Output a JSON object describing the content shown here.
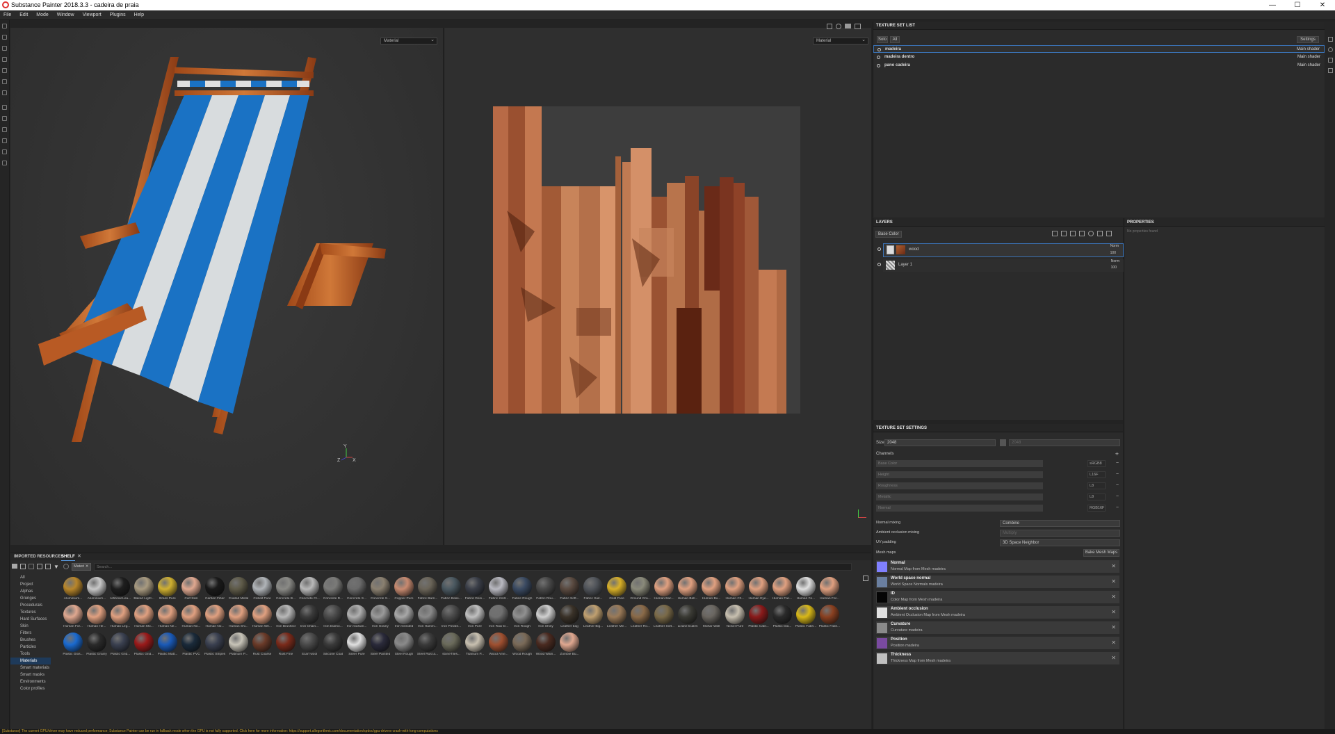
{
  "window": {
    "title": "Substance Painter 2018.3.3 - cadeira de praia"
  },
  "menu": [
    "File",
    "Edit",
    "Mode",
    "Window",
    "Viewport",
    "Plugins",
    "Help"
  ],
  "viewport3d": {
    "mode": "Material"
  },
  "viewport2d": {
    "mode": "Material"
  },
  "texture_set_list": {
    "title": "TEXTURE SET LIST",
    "solo": "Solo",
    "all": "All",
    "settings": "Settings",
    "items": [
      {
        "name": "madeira",
        "shader": "Main shader"
      },
      {
        "name": "madeira dentro",
        "shader": "Main shader"
      },
      {
        "name": "pano cadeira",
        "shader": "Main shader"
      }
    ]
  },
  "layers": {
    "title": "LAYERS",
    "channel": "Base Color",
    "items": [
      {
        "name": "wood",
        "blend": "Norm",
        "opacity": "100"
      },
      {
        "name": "Layer 1",
        "blend": "Norm",
        "opacity": "100"
      }
    ]
  },
  "properties": {
    "title": "PROPERTIES",
    "empty": "No properties found"
  },
  "texture_set_settings": {
    "title": "TEXTURE SET SETTINGS",
    "size_label": "Size",
    "size_value": "2048",
    "size_value2": "2048",
    "channels_label": "Channels",
    "channels": [
      {
        "name": "Base Color",
        "format": "sRGB8"
      },
      {
        "name": "Height",
        "format": "L16F"
      },
      {
        "name": "Roughness",
        "format": "L8"
      },
      {
        "name": "Metallic",
        "format": "L8"
      },
      {
        "name": "Normal",
        "format": "RGB16F"
      }
    ],
    "normal_mixing_label": "Normal mixing",
    "normal_mixing_value": "Combine",
    "ao_mixing_label": "Ambient occlusion mixing",
    "ao_mixing_value": "Multiply",
    "uv_padding_label": "UV padding",
    "uv_padding_value": "3D Space Neighbor",
    "mesh_maps_label": "Mesh maps",
    "bake_button": "Bake Mesh Maps",
    "mesh_maps": [
      {
        "name": "Normal",
        "desc": "Normal Map from Mesh madeira",
        "color": "#8080ff"
      },
      {
        "name": "World space normal",
        "desc": "World Space Normals madeira",
        "color": "#6a7fa0"
      },
      {
        "name": "ID",
        "desc": "Color Map from Mesh madeira",
        "color": "#050505"
      },
      {
        "name": "Ambient occlusion",
        "desc": "Ambient Occlusion Map from Mesh madeira",
        "color": "#e0e0e0"
      },
      {
        "name": "Curvature",
        "desc": "Curvature madeira",
        "color": "#8a8a8a"
      },
      {
        "name": "Position",
        "desc": "Position madeira",
        "color": "#7a4aa0"
      },
      {
        "name": "Thickness",
        "desc": "Thickness Map from Mesh madeira",
        "color": "#c0c0c0"
      }
    ]
  },
  "shelf": {
    "tab_imported": "IMPORTED RESOURCES",
    "tab_shelf": "SHELF",
    "filter_chip": "Materi",
    "search_placeholder": "Search...",
    "categories": [
      "All",
      "Project",
      "Alphas",
      "Grunges",
      "Procedurals",
      "Textures",
      "Hard Surfaces",
      "Skin",
      "Filters",
      "Brushes",
      "Particles",
      "Tools",
      "Materials",
      "Smart materials",
      "Smart masks",
      "Environments",
      "Color profiles"
    ],
    "selected_category": "Materials",
    "materials": [
      {
        "n": "Aluminium...",
        "c": "#b8862a"
      },
      {
        "n": "Aluminium...",
        "c": "#c8c8c8"
      },
      {
        "n": "Artificial Lea...",
        "c": "#1e1e1e"
      },
      {
        "n": "Baked Light...",
        "c": "#a89a80"
      },
      {
        "n": "Brass Pure",
        "c": "#d0b030"
      },
      {
        "n": "Calf Skin",
        "c": "#e0a890"
      },
      {
        "n": "Carbon Fiber",
        "c": "#1a1a1a"
      },
      {
        "n": "Coated Metal",
        "c": "#5e5a48"
      },
      {
        "n": "Cobalt Pure",
        "c": "#b0b4b8"
      },
      {
        "n": "Concrete B...",
        "c": "#8a8a86"
      },
      {
        "n": "Concrete Cl...",
        "c": "#b8b8b8"
      },
      {
        "n": "Concrete D...",
        "c": "#7a7a78"
      },
      {
        "n": "Concrete S...",
        "c": "#6a6a6a"
      },
      {
        "n": "Concrete S...",
        "c": "#8a8070"
      },
      {
        "n": "Copper Pure",
        "c": "#c88a70"
      },
      {
        "n": "Fabric Barn...",
        "c": "#6a6458"
      },
      {
        "n": "Fabric Base...",
        "c": "#4a5860"
      },
      {
        "n": "Fabric Deni...",
        "c": "#3a3e48"
      },
      {
        "n": "Fabric Knitt...",
        "c": "#b8b8c0"
      },
      {
        "n": "Fabric Rough",
        "c": "#3a4a62"
      },
      {
        "n": "Fabric Rou...",
        "c": "#484848"
      },
      {
        "n": "Fabric Soft...",
        "c": "#5a4a40"
      },
      {
        "n": "Fabric Suit...",
        "c": "#50545a"
      },
      {
        "n": "Gold Pure",
        "c": "#d8b028"
      },
      {
        "n": "Ground Gra...",
        "c": "#8a8a7a"
      },
      {
        "n": "Human Bac...",
        "c": "#e0a080"
      },
      {
        "n": "Human Bell...",
        "c": "#e0a080"
      },
      {
        "n": "Human Bu...",
        "c": "#e0a080"
      },
      {
        "n": "Human Ch...",
        "c": "#e0a080"
      },
      {
        "n": "Human Eye...",
        "c": "#e0a080"
      },
      {
        "n": "Human Fac...",
        "c": "#e0a080"
      },
      {
        "n": "Human Fe...",
        "c": "#e0e0e0"
      },
      {
        "n": "Human For...",
        "c": "#e0a080"
      },
      {
        "n": "Human For...",
        "c": "#e0a890"
      },
      {
        "n": "Human He...",
        "c": "#e0a080"
      },
      {
        "n": "Human Leg...",
        "c": "#e0a080"
      },
      {
        "n": "Human Mo...",
        "c": "#e0a080"
      },
      {
        "n": "Human Ne...",
        "c": "#e0a080"
      },
      {
        "n": "Human No...",
        "c": "#e0a080"
      },
      {
        "n": "Human No...",
        "c": "#e0a080"
      },
      {
        "n": "Human Shi...",
        "c": "#e0a080"
      },
      {
        "n": "Human Wri...",
        "c": "#e0a080"
      },
      {
        "n": "Iron Brushed",
        "c": "#b8b8b8"
      },
      {
        "n": "Iron Chain...",
        "c": "#3a3a3a"
      },
      {
        "n": "Iron Diamo...",
        "c": "#4a4a4a"
      },
      {
        "n": "Iron Galvan...",
        "c": "#b0b0b0"
      },
      {
        "n": "Iron Grainy",
        "c": "#9a9a9a"
      },
      {
        "n": "Iron Grinded",
        "c": "#a8a8a8"
      },
      {
        "n": "Iron Hamm...",
        "c": "#8a8a8a"
      },
      {
        "n": "Iron Powde...",
        "c": "#4a4a4a"
      },
      {
        "n": "Iron Pure",
        "c": "#c0c0c0"
      },
      {
        "n": "Iron Raw D...",
        "c": "#707070"
      },
      {
        "n": "Iron Rough",
        "c": "#909090"
      },
      {
        "n": "Iron Shiny",
        "c": "#d0d0d0"
      },
      {
        "n": "Leather bag",
        "c": "#3a3228"
      },
      {
        "n": "Leather Big...",
        "c": "#c0a070"
      },
      {
        "n": "Leather Me...",
        "c": "#9a7a58"
      },
      {
        "n": "Leather Ro...",
        "c": "#8a6a48"
      },
      {
        "n": "Leather Soft...",
        "c": "#7a6a48"
      },
      {
        "n": "Lizard Scales",
        "c": "#3a3a34"
      },
      {
        "n": "Mortar Wall",
        "c": "#6a6660"
      },
      {
        "n": "Nickel Pure",
        "c": "#c8c0b0"
      },
      {
        "n": "Plastic Cabl...",
        "c": "#8a1a1a"
      },
      {
        "n": "Plastic Dia...",
        "c": "#2a2a2a"
      },
      {
        "n": "Plastic Fabri...",
        "c": "#d8b818"
      },
      {
        "n": "Plastic Fabri...",
        "c": "#8a4020"
      },
      {
        "n": "Plastic Glos...",
        "c": "#1a6ad0"
      },
      {
        "n": "Plastic Grainy",
        "c": "#2a2a2a"
      },
      {
        "n": "Plastic Grid...",
        "c": "#3a4050"
      },
      {
        "n": "Plastic Grid...",
        "c": "#9a1a1a"
      },
      {
        "n": "Plastic Matt...",
        "c": "#1a5ab8"
      },
      {
        "n": "Plastic PVC",
        "c": "#1a2a3a"
      },
      {
        "n": "Plastic Stripes",
        "c": "#3a4050"
      },
      {
        "n": "Platinum P...",
        "c": "#c8c4b8"
      },
      {
        "n": "Rust Coarse",
        "c": "#6a3a28"
      },
      {
        "n": "Rust Fine",
        "c": "#7a2a1a"
      },
      {
        "n": "Scarf wool",
        "c": "#4a4a4a"
      },
      {
        "n": "Silicone Coat",
        "c": "#3a3a3a"
      },
      {
        "n": "Silver Pure",
        "c": "#e0e0e0"
      },
      {
        "n": "Steel Painted",
        "c": "#2a2a3a"
      },
      {
        "n": "Steel Rough",
        "c": "#8a8a8a"
      },
      {
        "n": "Steel Rust a...",
        "c": "#3a3a3a"
      },
      {
        "n": "stoneTiles...",
        "c": "#6a6a5a"
      },
      {
        "n": "Titanium P...",
        "c": "#c8c0b0"
      },
      {
        "n": "Wood Ame...",
        "c": "#a05030"
      },
      {
        "n": "Wood Rough",
        "c": "#7a6a58"
      },
      {
        "n": "Wood Waln...",
        "c": "#4a2a20"
      },
      {
        "n": "Zombie Bu...",
        "c": "#e0a890"
      }
    ]
  },
  "status": {
    "text": "[Substance] The current GPU/driver may have reduced performance; Substance Painter can be run in fallback mode when the GPU is not fully supported. Click here for more information: https://support.allegorithmic.com/documentation/spdoc/gpu-drivers-crash-with-long-computations"
  },
  "axis": {
    "x": "X",
    "y": "Y",
    "z": "Z"
  }
}
